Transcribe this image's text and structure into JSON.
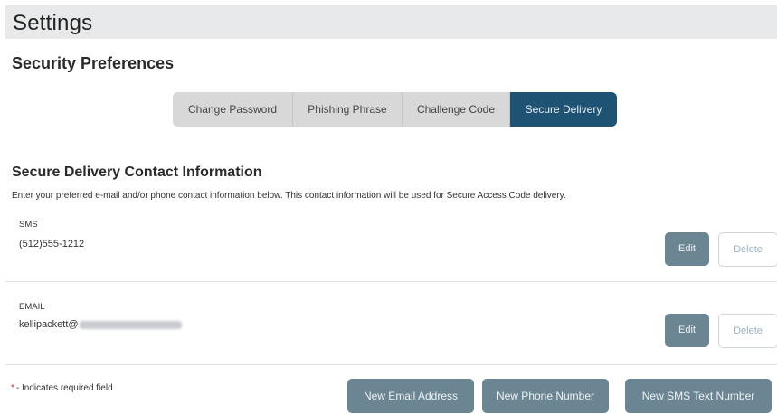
{
  "header": {
    "title": "Settings"
  },
  "section_title": "Security Preferences",
  "tabs": [
    {
      "label": "Change Password",
      "active": false
    },
    {
      "label": "Phishing Phrase",
      "active": false
    },
    {
      "label": "Challenge Code",
      "active": false
    },
    {
      "label": "Secure Delivery",
      "active": true
    }
  ],
  "contact": {
    "title": "Secure Delivery Contact Information",
    "description": "Enter your preferred e-mail and/or phone contact information below. This contact information will be used for Secure Access Code delivery.",
    "entries": [
      {
        "type": "SMS",
        "value": "(512)555-1212",
        "edit_label": "Edit",
        "delete_label": "Delete"
      },
      {
        "type": "EMAIL",
        "value": "kellipackett@",
        "edit_label": "Edit",
        "delete_label": "Delete"
      }
    ]
  },
  "footer": {
    "required_star": "*",
    "required_text": "- Indicates required field",
    "new_email_label": "New Email Address",
    "new_phone_label": "New Phone Number",
    "new_sms_label": "New SMS Text Number"
  },
  "colors": {
    "active_tab": "#1e5373",
    "button": "#6b8592",
    "header_bg": "#e8e9ea"
  }
}
